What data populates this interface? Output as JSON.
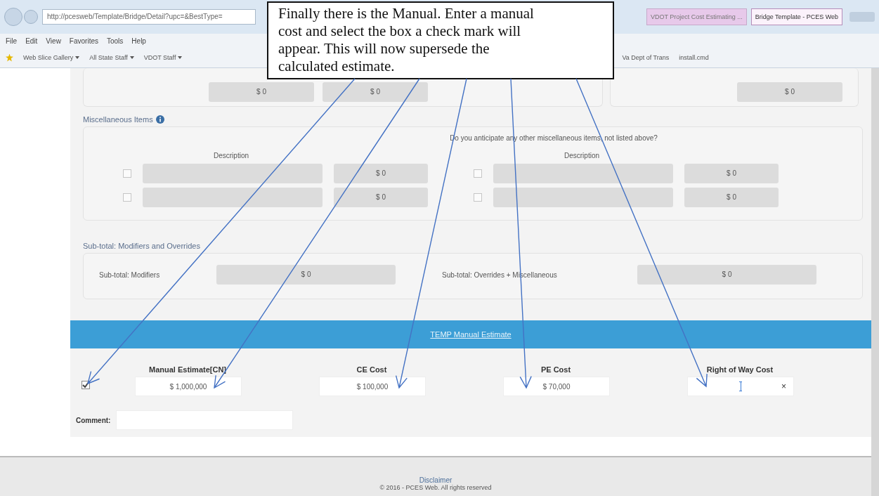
{
  "browser": {
    "address": "http://pcesweb/Template/Bridge/Detail?upc=&BestType=",
    "tabs": [
      {
        "label": "VDOT Project Cost Estimating ...",
        "selected": false
      },
      {
        "label": "Bridge Template - PCES Web",
        "selected": true
      }
    ],
    "menu": [
      "File",
      "Edit",
      "View",
      "Favorites",
      "Tools",
      "Help"
    ],
    "favorites": [
      {
        "label": "Web Slice Gallery",
        "dropdown": true
      },
      {
        "label": "All State Staff",
        "dropdown": true
      },
      {
        "label": "VDOT Staff",
        "dropdown": true
      },
      {
        "label": "Va Dept of Trans",
        "dropdown": false
      },
      {
        "label": "install.cmd",
        "dropdown": false
      }
    ]
  },
  "top_section": {
    "fields_left": [
      "$ 0",
      "$ 0"
    ],
    "field_right": "$ 0"
  },
  "misc": {
    "title": "Miscellaneous Items",
    "question": "Do you anticipate any other miscellaneous items, not listed above?",
    "column_headers": [
      "Description",
      "Description"
    ],
    "rows": [
      [
        {
          "checked": false,
          "amount": "$ 0"
        },
        {
          "checked": false,
          "amount": "$ 0"
        }
      ],
      [
        {
          "checked": false,
          "amount": "$ 0"
        },
        {
          "checked": false,
          "amount": "$ 0"
        }
      ]
    ]
  },
  "subtotal": {
    "title": "Sub-total: Modifiers and Overrides",
    "items": [
      {
        "label": "Sub-total: Modifiers",
        "value": "$ 0"
      },
      {
        "label": "Sub-total: Overrides + Miscellaneous",
        "value": "$ 0"
      }
    ]
  },
  "manual": {
    "banner": "TEMP Manual Estimate",
    "checked": true,
    "fields": [
      {
        "label": "Manual Estimate[CN]",
        "value": "$ 1,000,000"
      },
      {
        "label": "CE Cost",
        "value": "$ 100,000"
      },
      {
        "label": "PE Cost",
        "value": "$ 70,000"
      },
      {
        "label": "Right of Way Cost",
        "clear": "×"
      }
    ],
    "comment_label": "Comment:"
  },
  "footer": {
    "link": "Disclaimer",
    "copyright": "© 2016 - PCES Web. All rights reserved"
  },
  "callout": {
    "text": "Finally there is the Manual. Enter a manual cost and select the box a check mark will appear. This will now supersede the calculated estimate."
  }
}
